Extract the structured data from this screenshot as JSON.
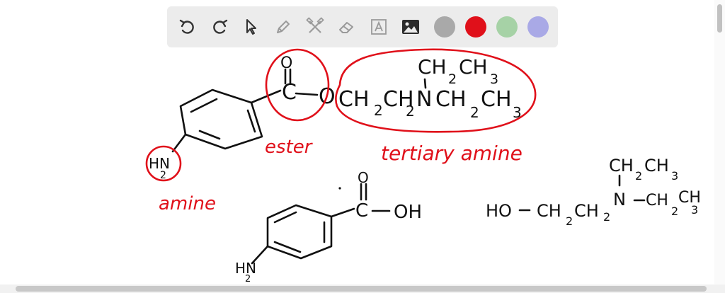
{
  "toolbar": {
    "tools": [
      {
        "name": "undo-icon"
      },
      {
        "name": "redo-icon"
      },
      {
        "name": "select-pointer-icon"
      },
      {
        "name": "pen-icon"
      },
      {
        "name": "tools-icon"
      },
      {
        "name": "eraser-icon"
      },
      {
        "name": "text-icon"
      },
      {
        "name": "image-icon"
      }
    ],
    "colors": [
      "#a9a9a9",
      "#e0101a",
      "#a6d2a6",
      "#a9a9e6"
    ]
  },
  "drawing": {
    "molecule1": {
      "carbonyl_c": "C",
      "carbonyl_o": "O",
      "ester_o": "O",
      "chain": [
        "CH",
        "2",
        "CH",
        "2",
        "N",
        "CH",
        "2",
        "CH",
        "3"
      ],
      "top_ethyl": [
        "CH",
        "2",
        "CH",
        "3"
      ],
      "amine": [
        "H",
        "N",
        "2"
      ]
    },
    "labels": {
      "ester": "ester",
      "tertiary_amine": "tertiary amine",
      "amine": "amine"
    },
    "molecule2": {
      "carbonyl_c": "C",
      "carbonyl_o": "O",
      "oh": "OH",
      "amine": [
        "H",
        "N",
        "2"
      ]
    },
    "molecule3": {
      "ho": "HO",
      "chain": [
        "CH",
        "2",
        "CH",
        "2",
        "N"
      ],
      "top_ethyl": [
        "CH",
        "2",
        "CH",
        "3"
      ],
      "right_ethyl": [
        "CH",
        "2",
        "CH",
        "3"
      ]
    }
  }
}
